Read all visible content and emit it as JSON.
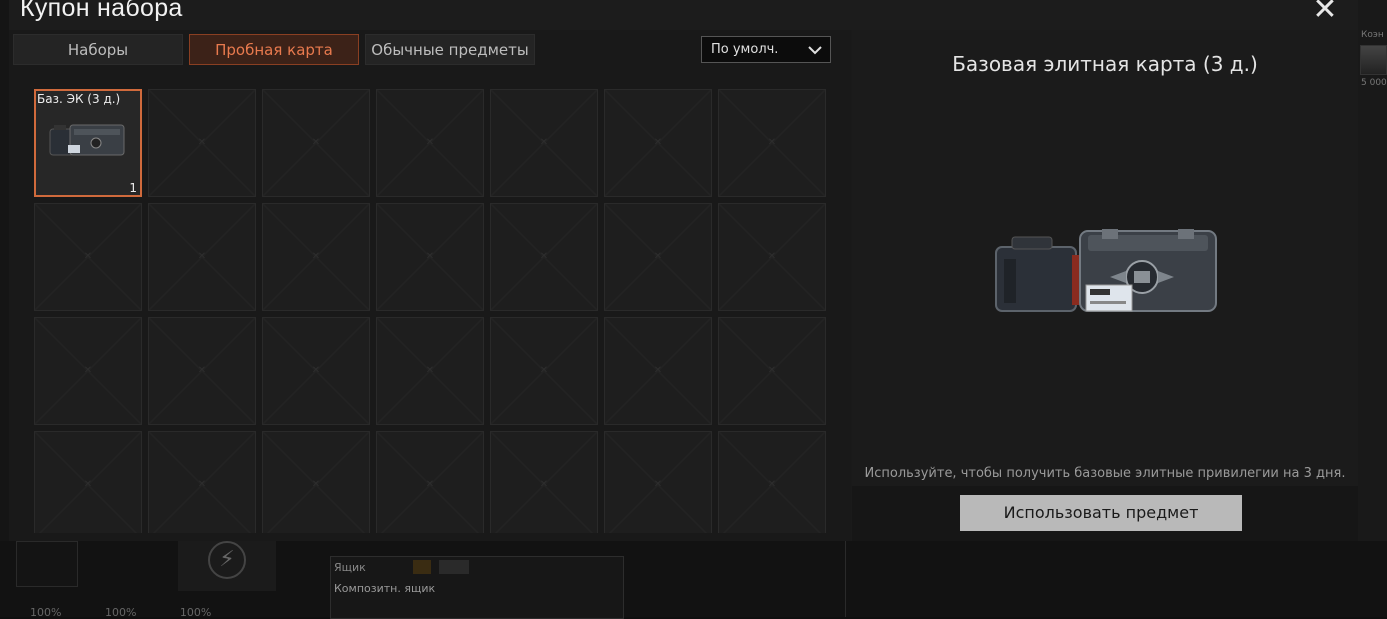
{
  "window": {
    "title": "Купон набора",
    "close_label": "✕"
  },
  "tabs": [
    {
      "label": "Наборы",
      "active": false
    },
    {
      "label": "Пробная карта",
      "active": true
    },
    {
      "label": "Обычные предметы",
      "active": false
    }
  ],
  "sort": {
    "selected": "По умолч."
  },
  "inventory": {
    "rows": 4,
    "cols": 7,
    "items": [
      {
        "label": "Баз. ЭК (3 д.)",
        "count": "1",
        "icon": "case-icon"
      }
    ]
  },
  "detail": {
    "title": "Базовая элитная карта (3 д.)",
    "description": "Используйте, чтобы получить базовые элитные привилегии на 3 дня.",
    "use_button": "Использовать предмет"
  },
  "background": {
    "right_label": "Коэн",
    "right_price": "5 000",
    "crate_title": "Ящик",
    "crate_sub": "Композитн. ящик",
    "stats": "100% 100% 100%"
  },
  "colors": {
    "accent": "#d06a3c",
    "active_tab_text": "#e87a4e"
  }
}
